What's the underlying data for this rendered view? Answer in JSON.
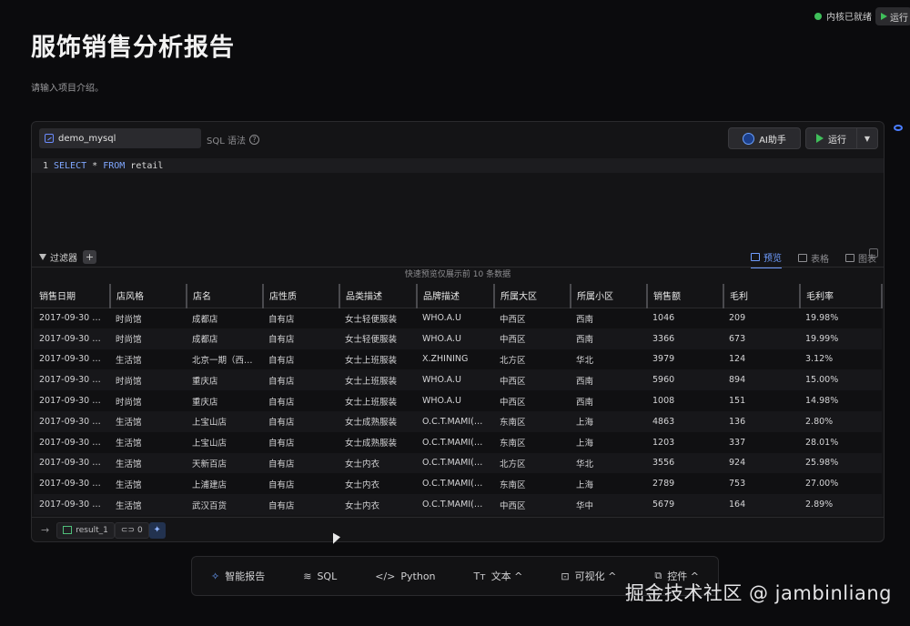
{
  "header": {
    "kernel_status": "内核已就绪",
    "top_run_label": "运行",
    "title": "服饰销售分析报告",
    "intro": "请输入项目介绍。"
  },
  "cell": {
    "database": "demo_mysql",
    "syntax_hint": "SQL 语法",
    "ai_button": "AI助手",
    "run_button": "运行",
    "code": {
      "line_no": "1",
      "kw_select": "SELECT",
      "star": " * ",
      "kw_from": "FROM",
      "table": " retail"
    },
    "filter_label": "过滤器",
    "view_tabs": [
      "预览",
      "表格",
      "图表"
    ],
    "preview_note": "快速预览仅展示前 10 条数据",
    "columns": [
      "销售日期",
      "店风格",
      "店名",
      "店性质",
      "品类描述",
      "品牌描述",
      "所属大区",
      "所属小区",
      "销售额",
      "毛利",
      "毛利率"
    ],
    "rows": [
      [
        "2017-09-30 …",
        "时尚馆",
        "成都店",
        "自有店",
        "女士轻便服装",
        "WHO.A.U",
        "中西区",
        "西南",
        "1046",
        "209",
        "19.98%"
      ],
      [
        "2017-09-30 …",
        "时尚馆",
        "成都店",
        "自有店",
        "女士轻便服装",
        "WHO.A.U",
        "中西区",
        "西南",
        "3366",
        "673",
        "19.99%"
      ],
      [
        "2017-09-30 …",
        "生活馆",
        "北京一期（西…",
        "自有店",
        "女士上班服装",
        "X.ZHINING",
        "北方区",
        "华北",
        "3979",
        "124",
        "3.12%"
      ],
      [
        "2017-09-30 …",
        "时尚馆",
        "重庆店",
        "自有店",
        "女士上班服装",
        "WHO.A.U",
        "中西区",
        "西南",
        "5960",
        "894",
        "15.00%"
      ],
      [
        "2017-09-30 …",
        "时尚馆",
        "重庆店",
        "自有店",
        "女士上班服装",
        "WHO.A.U",
        "中西区",
        "西南",
        "1008",
        "151",
        "14.98%"
      ],
      [
        "2017-09-30 …",
        "生活馆",
        "上宝山店",
        "自有店",
        "女士成熟服装",
        "O.C.T.MAMI(…",
        "东南区",
        "上海",
        "4863",
        "136",
        "2.80%"
      ],
      [
        "2017-09-30 …",
        "生活馆",
        "上宝山店",
        "自有店",
        "女士成熟服装",
        "O.C.T.MAMI(…",
        "东南区",
        "上海",
        "1203",
        "337",
        "28.01%"
      ],
      [
        "2017-09-30 …",
        "生活馆",
        "天新百店",
        "自有店",
        "女士内衣",
        "O.C.T.MAMI(…",
        "北方区",
        "华北",
        "3556",
        "924",
        "25.98%"
      ],
      [
        "2017-09-30 …",
        "生活馆",
        "上浦建店",
        "自有店",
        "女士内衣",
        "O.C.T.MAMI(…",
        "东南区",
        "上海",
        "2789",
        "753",
        "27.00%"
      ],
      [
        "2017-09-30 …",
        "生活馆",
        "武汉百货",
        "自有店",
        "女士内衣",
        "O.C.T.MAMI(…",
        "中西区",
        "华中",
        "5679",
        "164",
        "2.89%"
      ]
    ],
    "result_name": "result_1",
    "link_count": "0"
  },
  "insert_bar": {
    "items": [
      {
        "label": "智能报告",
        "icon": "magic-wand-icon",
        "glyph": "✧"
      },
      {
        "label": "SQL",
        "icon": "database-icon",
        "glyph": "≋"
      },
      {
        "label": "Python",
        "icon": "code-icon",
        "glyph": "</>"
      },
      {
        "label": "文本 ^",
        "icon": "text-icon",
        "glyph": "Tт"
      },
      {
        "label": "可视化 ^",
        "icon": "chart-icon",
        "glyph": "⊡"
      },
      {
        "label": "控件 ^",
        "icon": "widget-icon",
        "glyph": "⧉"
      }
    ]
  },
  "watermark": "掘金技术社区 @ jambinliang",
  "colors": {
    "background": "#0b0b0d",
    "accent": "#6f9dff",
    "run_green": "#3fbf5a"
  }
}
